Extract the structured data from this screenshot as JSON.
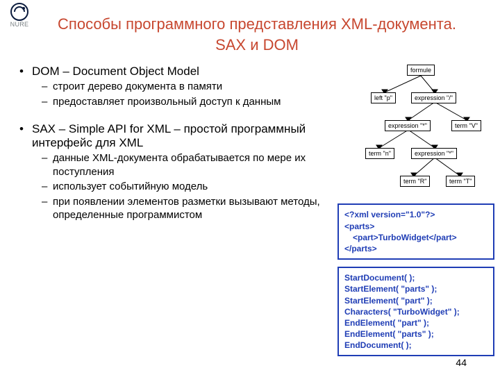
{
  "logo_text": "NURE",
  "title": "Способы программного представления XML-документа. SAX и DOM",
  "bullets": {
    "dom_head": "DOM – Document Object Model",
    "dom_sub1": "строит дерево документа в памяти",
    "dom_sub2": "предоставляет произвольный доступ к данным",
    "sax_head": "SAX – Simple API for XML – простой программный интерфейс для XML",
    "sax_sub1": "данные XML-документа обрабатывается по мере их поступления",
    "sax_sub2": "использует событийную модель",
    "sax_sub3": "при появлении элементов разметки вызывают методы, определенные программистом"
  },
  "tree": {
    "n0": "formule",
    "n1": "left \"p\"",
    "n2": "expression \"/\"",
    "n3": "expression \"*\"",
    "n4": "term \"V\"",
    "n5": "term \"n\"",
    "n6": "expression \"*\"",
    "n7": "term \"R\"",
    "n8": "term \"T\""
  },
  "xmlbox": {
    "l1": "<?xml version=\"1.0\"?>",
    "l2": "<parts>",
    "l3": "<part>TurboWidget</part>",
    "l4": "</parts>"
  },
  "saxbox": {
    "l1": "StartDocument( );",
    "l2": "StartElement( \"parts\" );",
    "l3": "StartElement( \"part\" );",
    "l4": "Characters( \"TurboWidget\" );",
    "l5": "EndElement( \"part\" );",
    "l6": "EndElement( \"parts\" );",
    "l7": "EndDocument( );"
  },
  "page_number": "44"
}
